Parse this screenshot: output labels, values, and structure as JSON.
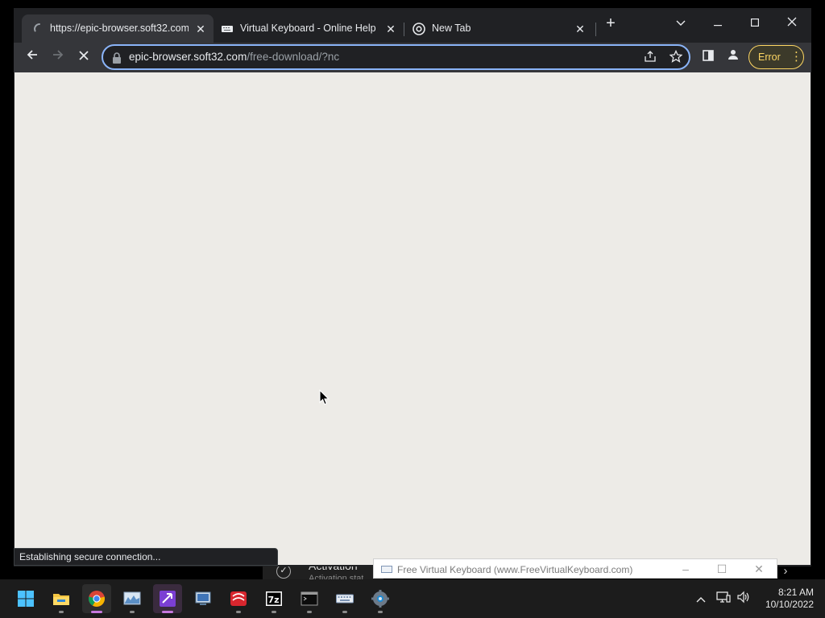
{
  "browser": {
    "tabs": [
      {
        "title": "https://epic-browser.soft32.com/",
        "state": "loading",
        "active": true
      },
      {
        "title": "Virtual Keyboard - Online Help",
        "icon": "keyboard-icon",
        "active": false
      },
      {
        "title": "New Tab",
        "icon": "chrome-icon",
        "active": false
      }
    ],
    "new_tab_symbol": "+",
    "omnibox": {
      "host": "epic-browser.soft32.com",
      "path": "/free-download/?nc"
    },
    "error_chip": "Error",
    "status": "Establishing secure connection...",
    "colors": {
      "accent": "#8ab4f8",
      "error": "#fdd663",
      "page": "#edebe7"
    }
  },
  "behind": {
    "activation_title": "Activation",
    "activation_sub": "Activation stat"
  },
  "virtual_keyboard": {
    "title": "Free Virtual Keyboard (www.FreeVirtualKeyboard.com)"
  },
  "taskbar": {
    "apps": [
      "windows-start-icon",
      "file-explorer-icon",
      "chrome-icon",
      "monitor-app-icon",
      "visual-studio-icon",
      "remote-desktop-icon",
      "wall-icon",
      "7zip-icon",
      "terminal-icon",
      "keyboard-icon",
      "settings-icon"
    ],
    "clock": {
      "time": "8:21 AM",
      "date": "10/10/2022"
    }
  }
}
